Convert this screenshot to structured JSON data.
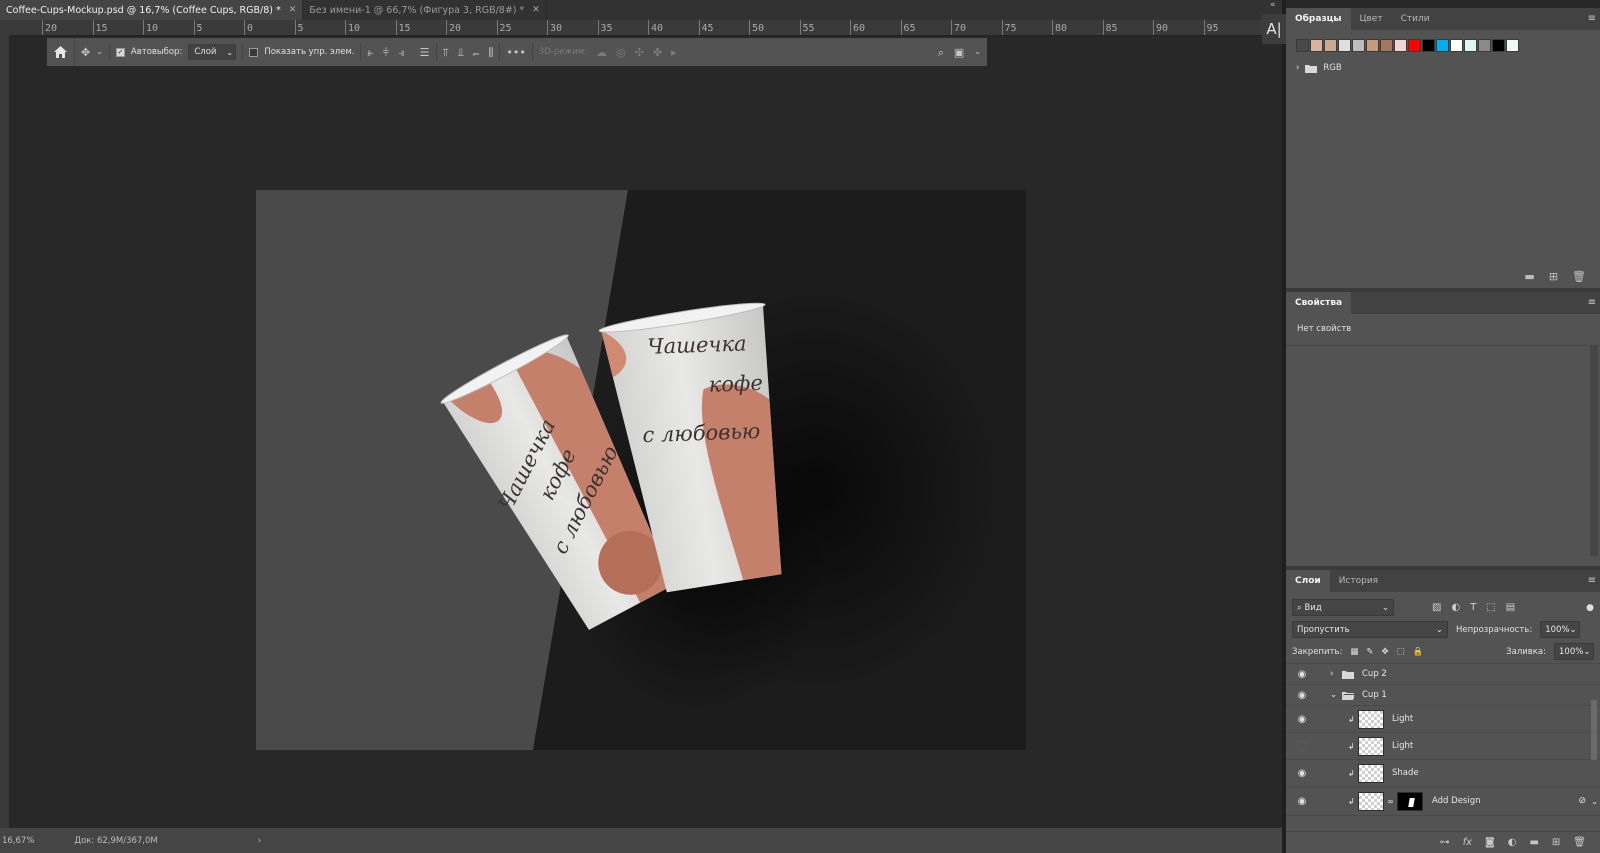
{
  "document_tabs": [
    {
      "title": "Coffee-Cups-Mockup.psd @ 16,7% (Coffee Cups, RGB/8) *",
      "active": true
    },
    {
      "title": "Без имени-1 @ 66,7% (Фигура 3, RGB/8#) *",
      "active": false
    }
  ],
  "ruler": {
    "labels": [
      "20",
      "15",
      "10",
      "5",
      "0",
      "5",
      "10",
      "15",
      "20",
      "25",
      "30",
      "35",
      "40",
      "45",
      "50",
      "55",
      "60",
      "65",
      "70",
      "75",
      "80",
      "85",
      "90",
      "95"
    ]
  },
  "options_bar": {
    "autoselect_label": "Автовыбор:",
    "autoselect_value": "Слой",
    "show_transform_label": "Показать упр. элем.",
    "mode_3d_label": "3D-режим:"
  },
  "tools_strip": {
    "label": "A|"
  },
  "canvas_text": {
    "cup_left": [
      "Чашечка",
      "кофе",
      "с любовью"
    ],
    "cup_right": [
      "Чашечка",
      "кофе",
      "с любовью"
    ]
  },
  "swatches_panel": {
    "tabs": [
      "Образцы",
      "Цвет",
      "Стили"
    ],
    "colors": [
      "#4a4a4a",
      "#d8b49e",
      "#c9a990",
      "#dedede",
      "#bdbdbd",
      "#c49b7f",
      "#a4785f",
      "#f1d3d3",
      "#ff0000",
      "#000000",
      "#00aeef",
      "#ffffff",
      "#e0f5f5",
      "#8a8a8a",
      "#000000",
      "#f0f9f0"
    ],
    "folder_label": "RGB"
  },
  "properties_panel": {
    "title": "Свойства",
    "empty_text": "Нет свойств"
  },
  "layers_panel": {
    "tabs": [
      "Слои",
      "История"
    ],
    "filter_value": "Вид",
    "blend_mode": "Пропустить",
    "opacity_label": "Непрозрачность:",
    "opacity_value": "100%",
    "lock_label": "Закрепить:",
    "fill_label": "Заливка:",
    "fill_value": "100%",
    "layers": [
      {
        "name": "Cup 2",
        "visible": true,
        "type": "group-collapsed"
      },
      {
        "name": "Cup 1",
        "visible": true,
        "type": "group-expanded"
      },
      {
        "name": "Light",
        "visible": true,
        "type": "clipped"
      },
      {
        "name": "Light",
        "visible": false,
        "type": "clipped"
      },
      {
        "name": "Shade",
        "visible": true,
        "type": "clipped"
      },
      {
        "name": "Add Design",
        "visible": true,
        "type": "smart-with-mask"
      }
    ]
  },
  "status_bar": {
    "zoom": "16,67%",
    "doc_info": "Док: 62,9M/367,0M"
  }
}
